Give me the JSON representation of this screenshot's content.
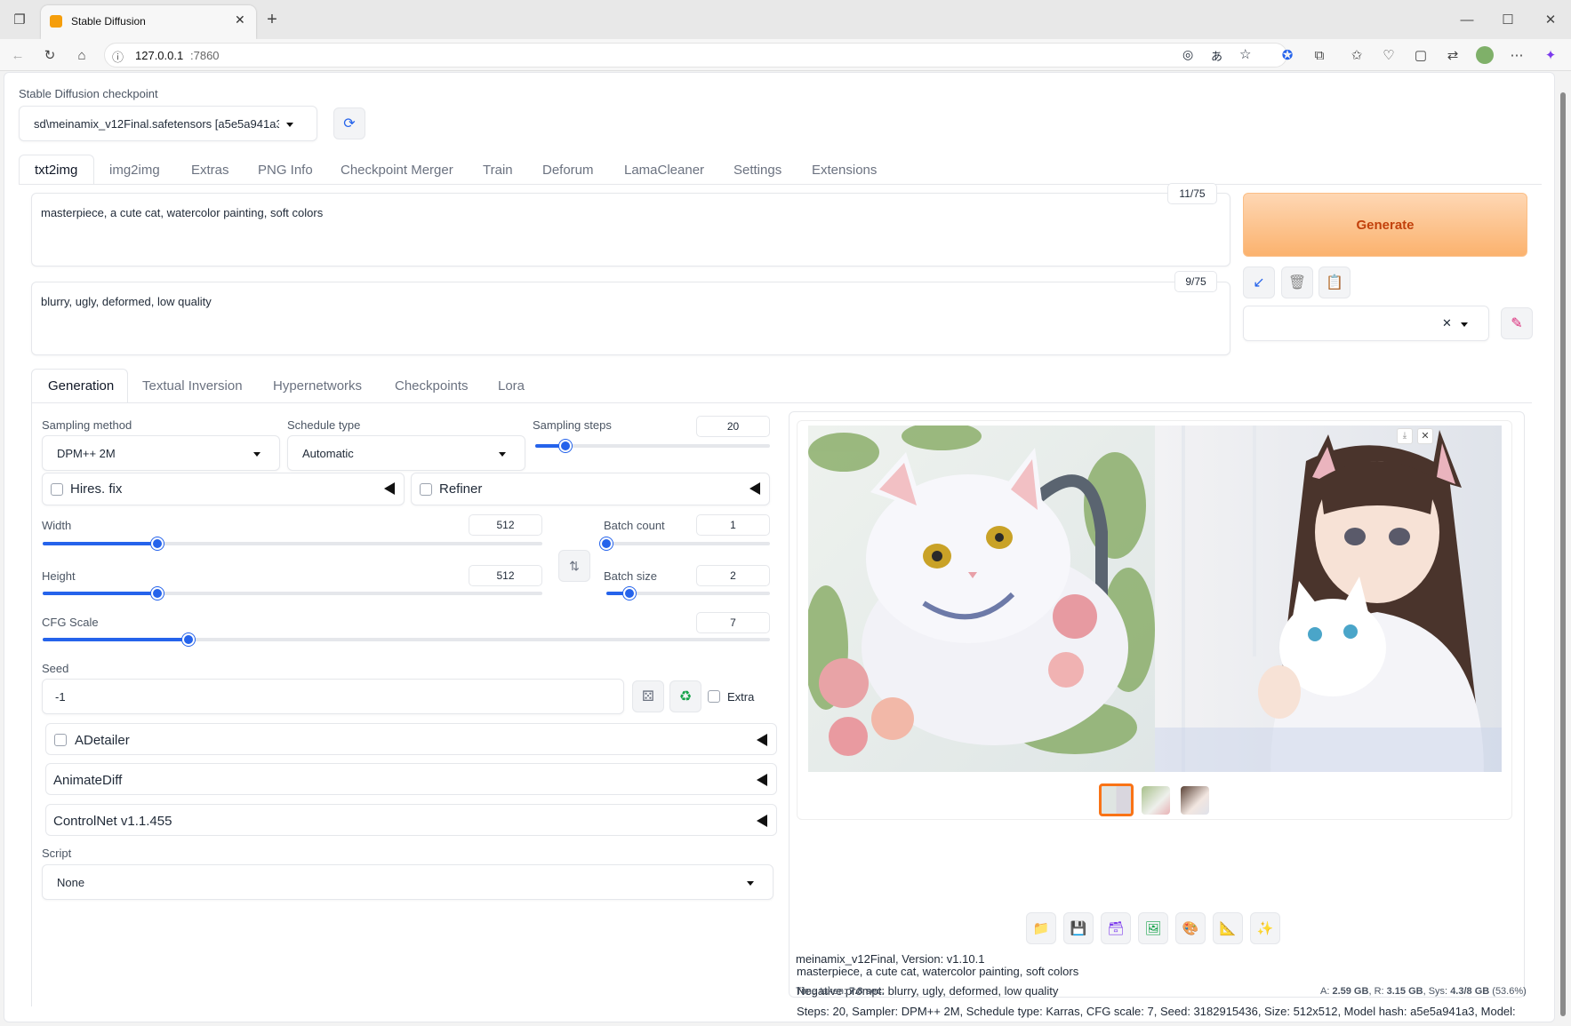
{
  "browser": {
    "tab_title": "Stable Diffusion",
    "url_host": "127.0.0.1",
    "url_port": ":7860"
  },
  "checkpoint": {
    "label": "Stable Diffusion checkpoint",
    "value": "sd\\meinamix_v12Final.safetensors [a5e5a941a3"
  },
  "main_tabs": [
    "txt2img",
    "img2img",
    "Extras",
    "PNG Info",
    "Checkpoint Merger",
    "Train",
    "Deforum",
    "LamaCleaner",
    "Settings",
    "Extensions"
  ],
  "prompt": {
    "positive": "masterpiece, a cute cat, watercolor painting, soft colors",
    "positive_count": "11/75",
    "negative": "blurry, ugly, deformed, low quality",
    "negative_count": "9/75"
  },
  "generate_label": "Generate",
  "sub_tabs": [
    "Generation",
    "Textual Inversion",
    "Hypernetworks",
    "Checkpoints",
    "Lora"
  ],
  "sampling": {
    "method_label": "Sampling method",
    "method_value": "DPM++ 2M",
    "schedule_label": "Schedule type",
    "schedule_value": "Automatic",
    "steps_label": "Sampling steps",
    "steps_value": "20",
    "steps_fraction": 0.13
  },
  "hires_label": "Hires. fix",
  "refiner_label": "Refiner",
  "width": {
    "label": "Width",
    "value": "512",
    "fraction": 0.23
  },
  "height": {
    "label": "Height",
    "value": "512",
    "fraction": 0.23
  },
  "batch_count": {
    "label": "Batch count",
    "value": "1",
    "fraction": 0.0
  },
  "batch_size": {
    "label": "Batch size",
    "value": "2",
    "fraction": 0.14
  },
  "cfg": {
    "label": "CFG Scale",
    "value": "7",
    "fraction": 0.2
  },
  "seed": {
    "label": "Seed",
    "value": "-1",
    "extra_label": "Extra"
  },
  "accordions": {
    "adetailer": "ADetailer",
    "animatediff": "AnimateDiff",
    "controlnet": "ControlNet v1.1.455"
  },
  "script": {
    "label": "Script",
    "value": "None"
  },
  "output": {
    "line1": "masterpiece, a cute cat, watercolor painting, soft colors",
    "line2": "Negative prompt: blurry, ugly, deformed, low quality",
    "line3": "Steps: 20, Sampler: DPM++ 2M, Schedule type: Karras, CFG scale: 7, Seed: 3182915436, Size: 512x512, Model hash: a5e5a941a3, Model:",
    "line4": "meinamix_v12Final, Version: v1.10.1",
    "time_label": "Time taken:",
    "time_value": "7.8 sec.",
    "mem_a_label": "A:",
    "mem_a": "2.59 GB",
    "mem_r_label": "R:",
    "mem_r": "3.15 GB",
    "mem_sys_label": "Sys:",
    "mem_sys": "4.3/8 GB",
    "mem_pct": "(53.6%)"
  },
  "colors": {
    "accent": "#2563eb",
    "generate_start": "#fdd5b0",
    "generate_end": "#fba862",
    "generate_text": "#c2410c"
  }
}
